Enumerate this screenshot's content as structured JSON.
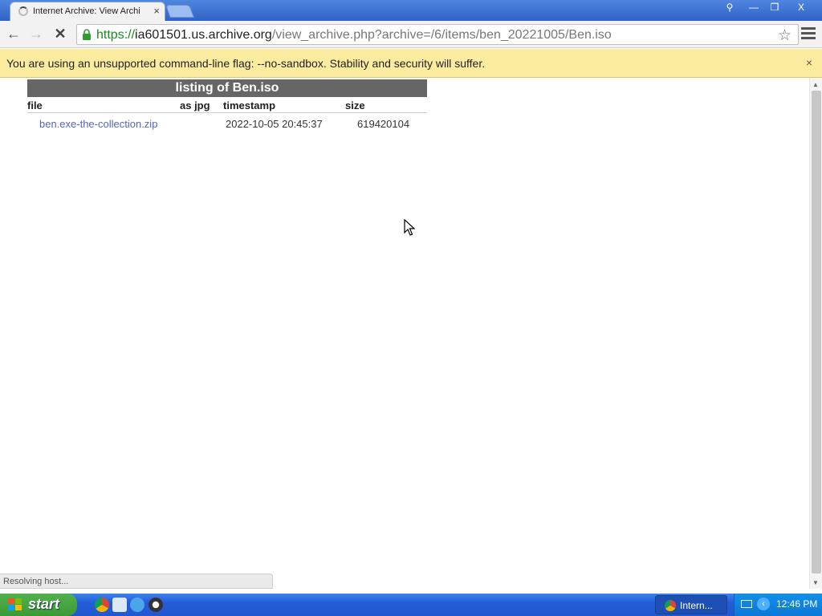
{
  "browser": {
    "tab": {
      "title": "Internet Archive: View Archi",
      "close": "×"
    },
    "window_controls": {
      "user": "⚲",
      "minimize": "—",
      "maximize": "❐",
      "close": "X"
    },
    "toolbar": {
      "back": "←",
      "forward": "→",
      "stop": "✕"
    },
    "address": {
      "scheme": "https://",
      "host": "ia601501.us.archive.org",
      "path": "/view_archive.php?archive=/6/items/ben_20221005/Ben.iso"
    },
    "star": "☆"
  },
  "infobar": {
    "message": "You are using an unsupported command-line flag: --no-sandbox. Stability and security will suffer.",
    "close": "×"
  },
  "listing": {
    "caption": "listing of Ben.iso",
    "columns": {
      "file": "file",
      "as_jpg": "as jpg",
      "timestamp": "timestamp",
      "size": "size"
    },
    "rows": [
      {
        "file": "ben.exe-the-collection.zip",
        "as_jpg": "",
        "timestamp": "2022-10-05 20:45:37",
        "size": "619420104"
      }
    ]
  },
  "status_bubble": "Resolving host...",
  "taskbar": {
    "start": "start",
    "task_button": "Intern...",
    "clock": "12:46 PM"
  },
  "colors": {
    "infobar_bg": "#fbeca0",
    "listing_header_bg": "#666666",
    "link": "#5566bb",
    "url_scheme": "#1a8a1a"
  }
}
